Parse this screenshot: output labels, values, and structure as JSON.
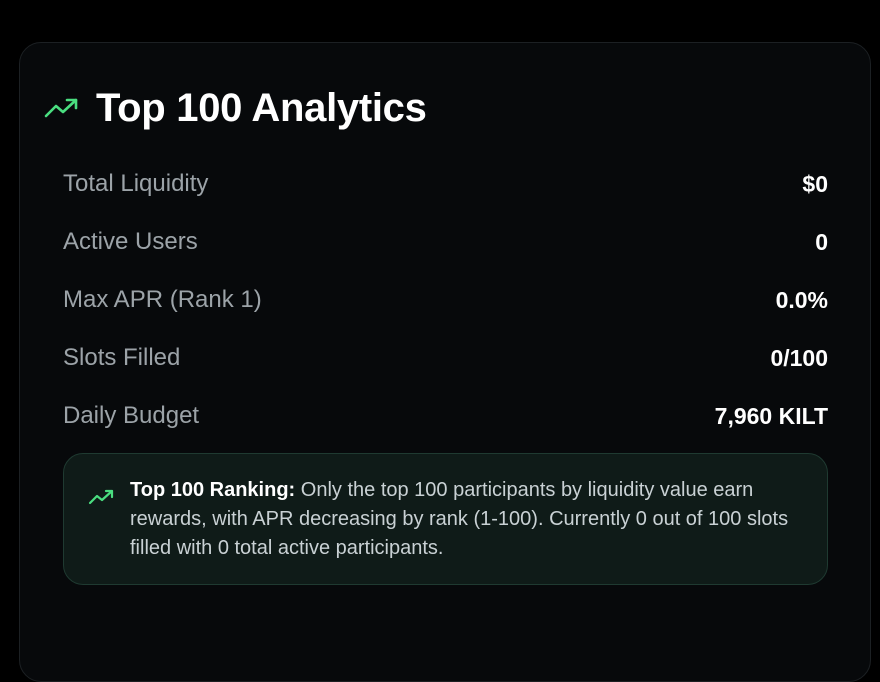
{
  "card": {
    "title": "Top 100 Analytics",
    "title_icon": "trending-up-icon",
    "accent_color": "#4ade80"
  },
  "stats": [
    {
      "label": "Total Liquidity",
      "value": "$0"
    },
    {
      "label": "Active Users",
      "value": "0"
    },
    {
      "label": "Max APR (Rank 1)",
      "value": "0.0%"
    },
    {
      "label": "Slots Filled",
      "value": "0/100"
    },
    {
      "label": "Daily Budget",
      "value": "7,960 KILT"
    }
  ],
  "info": {
    "icon": "trending-up-icon",
    "heading": "Top 100 Ranking:",
    "text": "Only the top 100 participants by liquidity value earn rewards, with APR decreasing by rank (1-100). Currently 0 out of 100 slots filled with 0 total active participants."
  }
}
